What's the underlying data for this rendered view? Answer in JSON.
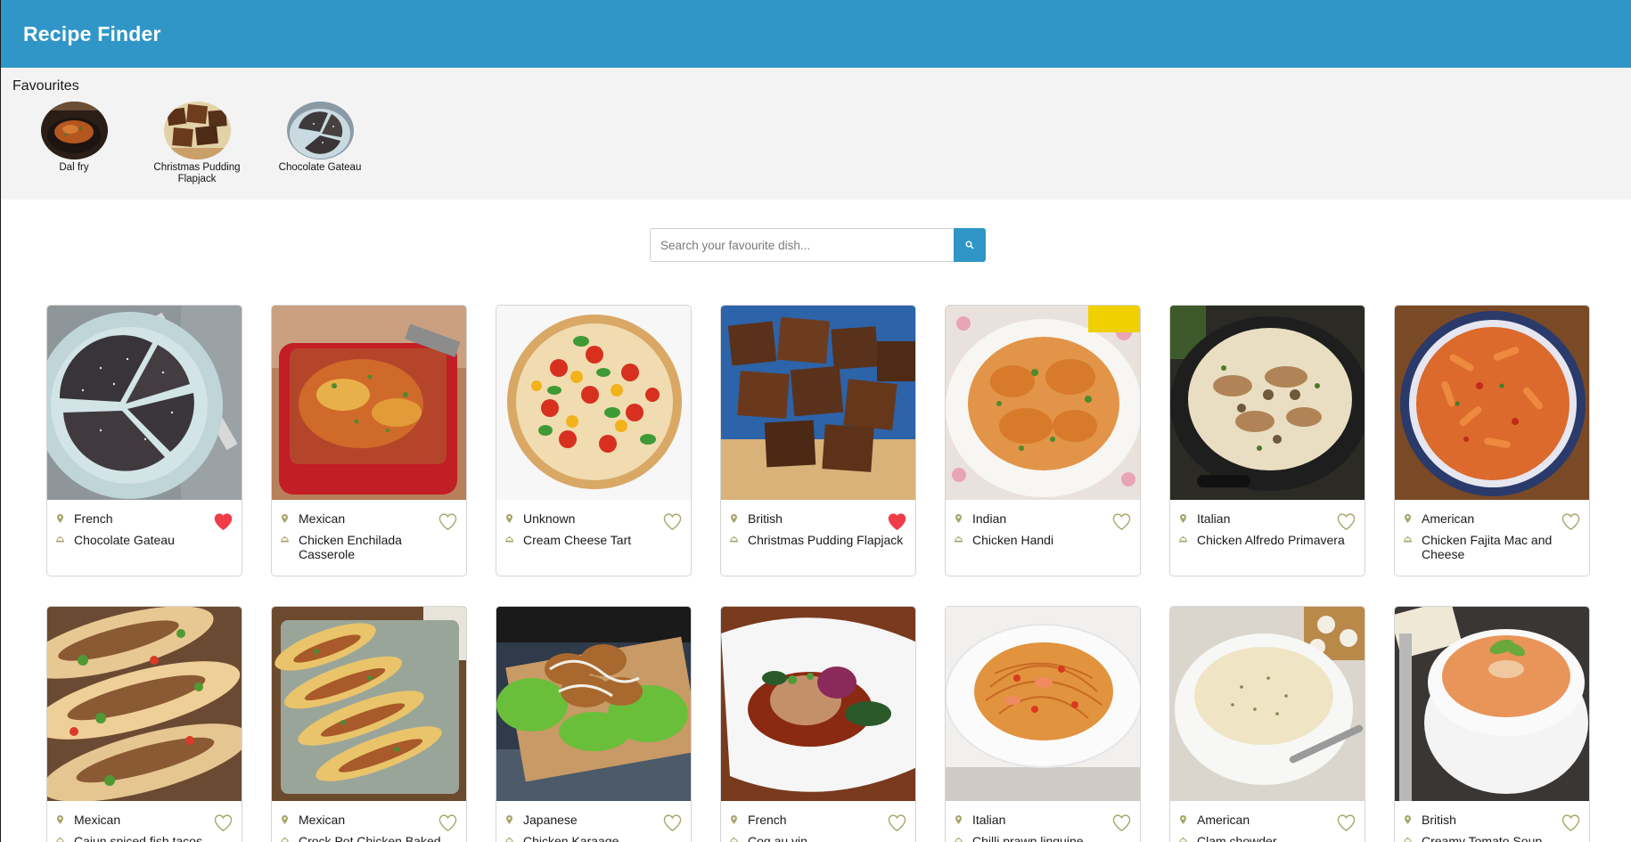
{
  "app": {
    "title": "Recipe Finder"
  },
  "colors": {
    "accent": "#3096c8",
    "heart_active": "#f03c49",
    "heart_inactive": "#a7a56a",
    "meta_icon": "#a7a56a"
  },
  "favourites": {
    "heading": "Favourites",
    "items": [
      {
        "name": "Dal fry"
      },
      {
        "name": "Christmas Pudding Flapjack"
      },
      {
        "name": "Chocolate Gateau"
      }
    ]
  },
  "search": {
    "placeholder": "Search your favourite dish...",
    "value": "",
    "button_icon": "search-icon"
  },
  "recipes": [
    {
      "cuisine": "French",
      "name": "Chocolate Gateau",
      "favourite": true
    },
    {
      "cuisine": "Mexican",
      "name": "Chicken Enchilada Casserole",
      "favourite": false
    },
    {
      "cuisine": "Unknown",
      "name": "Cream Cheese Tart",
      "favourite": false
    },
    {
      "cuisine": "British",
      "name": "Christmas Pudding Flapjack",
      "favourite": true
    },
    {
      "cuisine": "Indian",
      "name": "Chicken Handi",
      "favourite": false
    },
    {
      "cuisine": "Italian",
      "name": "Chicken Alfredo Primavera",
      "favourite": false
    },
    {
      "cuisine": "American",
      "name": "Chicken Fajita Mac and Cheese",
      "favourite": false
    },
    {
      "cuisine": "Mexican",
      "name": "Cajun spiced fish tacos",
      "favourite": false
    },
    {
      "cuisine": "Mexican",
      "name": "Crock Pot Chicken Baked Tacos",
      "favourite": false
    },
    {
      "cuisine": "Japanese",
      "name": "Chicken Karaage",
      "favourite": false
    },
    {
      "cuisine": "French",
      "name": "Coq au vin",
      "favourite": false
    },
    {
      "cuisine": "Italian",
      "name": "Chilli prawn linguine",
      "favourite": false
    },
    {
      "cuisine": "American",
      "name": "Clam chowder",
      "favourite": false
    },
    {
      "cuisine": "British",
      "name": "Creamy Tomato Soup",
      "favourite": false
    }
  ]
}
